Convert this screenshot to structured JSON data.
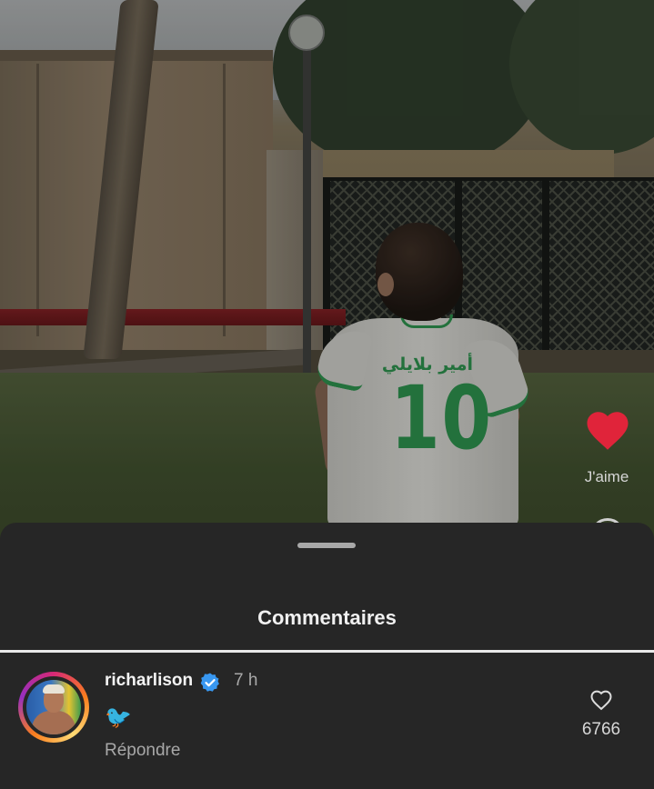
{
  "video": {
    "jersey_name": "أمير بلايلي",
    "jersey_number": "10",
    "like_label": "J'aime"
  },
  "comments_sheet": {
    "title": "Commentaires"
  },
  "comments": [
    {
      "username": "richarlison",
      "verified": true,
      "time": "7 h",
      "text": "🐦",
      "reply_label": "Répondre",
      "likes": "6766"
    }
  ],
  "colors": {
    "sheet_background": "#262626",
    "like_red": "#e0243a",
    "verified_blue": "#3897f0",
    "muted_text": "#a8a8a8"
  },
  "icons": {
    "video_like": "heart-filled-icon",
    "comment_like": "heart-outline-icon",
    "verified": "verified-badge-icon"
  }
}
